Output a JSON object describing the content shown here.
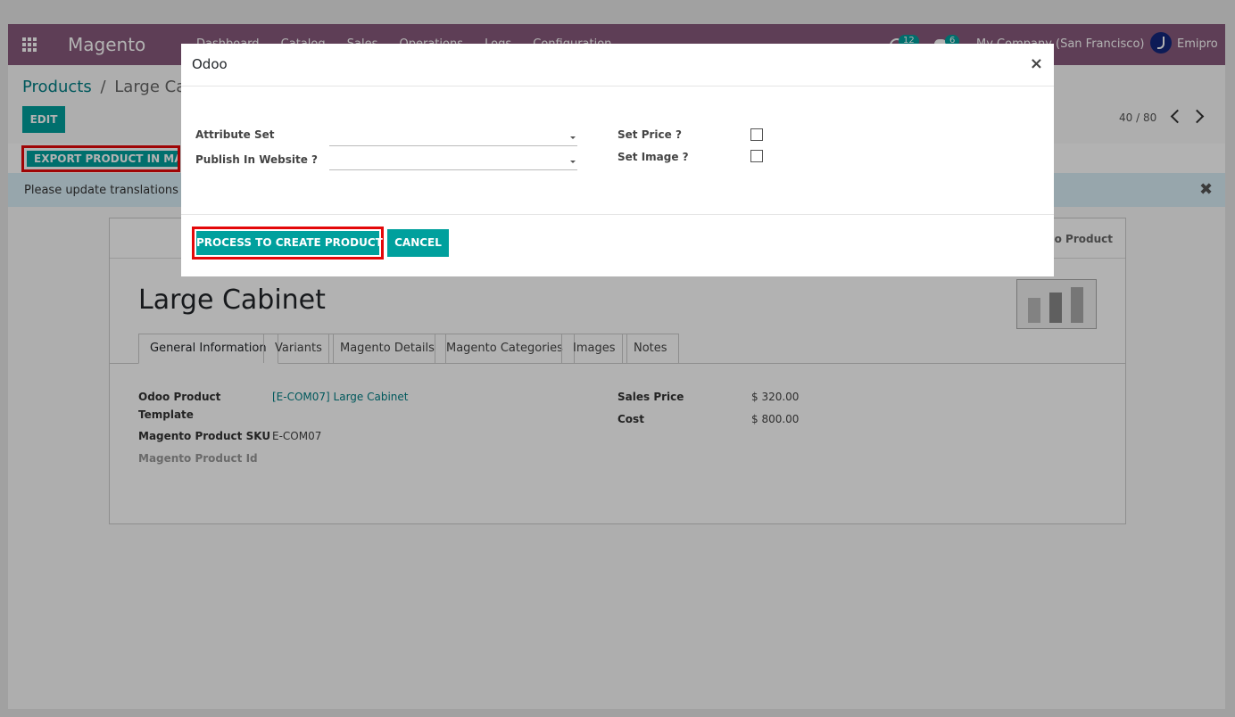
{
  "navbar": {
    "brand": "Magento",
    "menu": [
      "Dashboard",
      "Catalog",
      "Sales",
      "Operations",
      "Logs",
      "Configuration"
    ],
    "activity_count": "12",
    "message_count": "6",
    "company": "My Company (San Francisco)",
    "user": "Emipro",
    "color": "#875a7b"
  },
  "breadcrumb": {
    "parent": "Products",
    "separator": "/",
    "current": "Large Cabinet"
  },
  "toolbar": {
    "edit_label": "EDIT",
    "pager": "40 / 80"
  },
  "header": {
    "export_label": "EXPORT PRODUCT IN MAGENTO"
  },
  "alert": {
    "message": "Please update translations of :"
  },
  "sheet": {
    "smart_button": "Odoo Product",
    "title": "Large Cabinet",
    "tabs": [
      "General Information",
      "Variants",
      "Magento Details",
      "Magento Categories",
      "Images",
      "Notes"
    ],
    "fields": {
      "odoo_template_label_1": "Odoo Product",
      "odoo_template_label_2": "Template",
      "odoo_template_value": "[E-COM07] Large Cabinet",
      "sku_label": "Magento Product SKU",
      "sku_value": "E-COM07",
      "id_label": "Magento Product Id",
      "sales_price_label": "Sales Price",
      "sales_price_value": "$ 320.00",
      "cost_label": "Cost",
      "cost_value": "$ 800.00"
    }
  },
  "modal": {
    "title": "Odoo",
    "attribute_set_label": "Attribute Set",
    "publish_label": "Publish In Website ?",
    "set_price_label": "Set Price ?",
    "set_image_label": "Set Image ?",
    "process_label": "PROCESS TO CREATE PRODUCT",
    "cancel_label": "CANCEL",
    "accent": "#00a09d",
    "highlight": "#e4080a"
  }
}
